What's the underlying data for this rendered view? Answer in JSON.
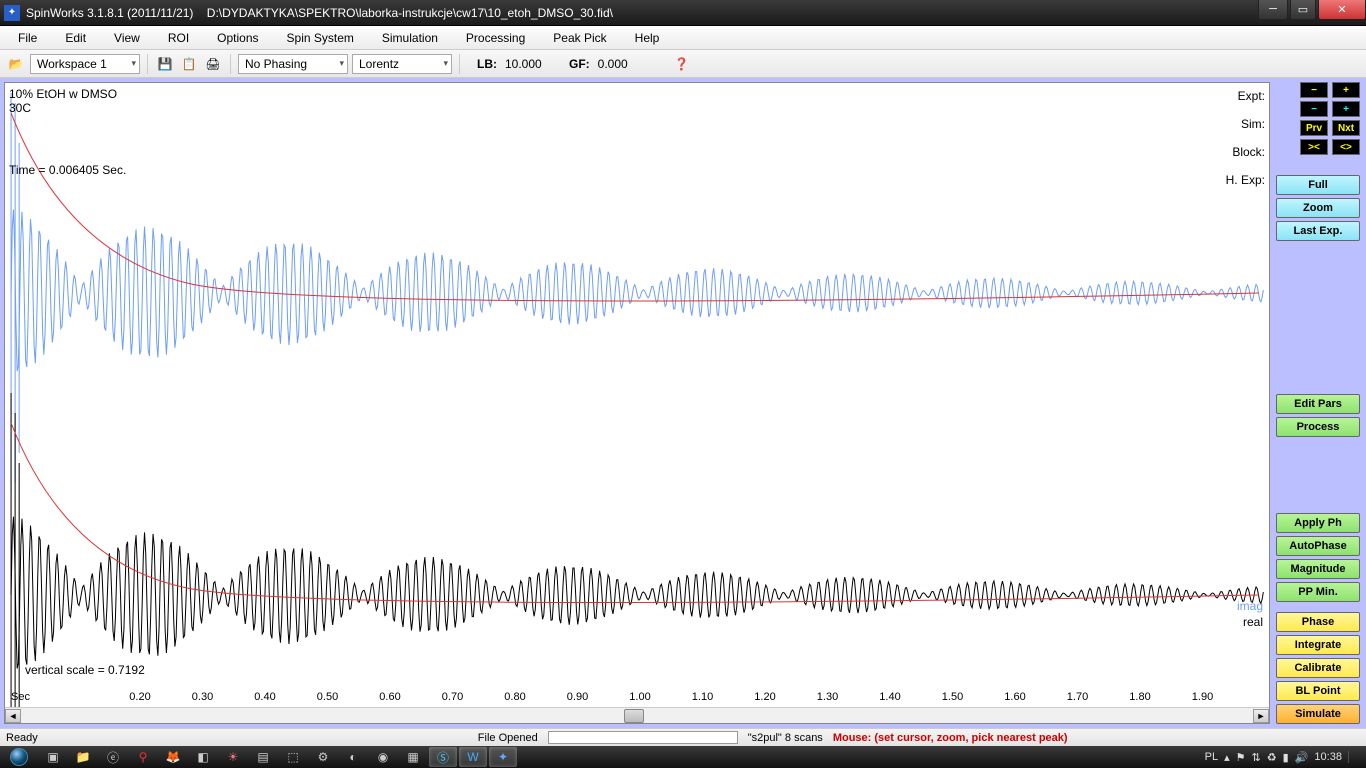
{
  "titlebar": {
    "app": "SpinWorks 3.1.8.1 (2011/11/21)",
    "path": "D:\\DYDAKTYKA\\SPEKTRO\\laborka-instrukcje\\cw17\\10_etoh_DMSO_30.fid\\"
  },
  "menu": [
    "File",
    "Edit",
    "View",
    "ROI",
    "Options",
    "Spin System",
    "Simulation",
    "Processing",
    "Peak Pick",
    "Help"
  ],
  "toolbar": {
    "workspace": "Workspace 1",
    "phasing": "No Phasing",
    "window": "Lorentz",
    "lb_label": "LB:",
    "lb_val": "10.000",
    "gf_label": "GF:",
    "gf_val": "0.000"
  },
  "plot": {
    "line1": "10% EtOH w DMSO",
    "line2": "30C",
    "time": "Time = 0.006405 Sec.",
    "vscale": "vertical scale = 0.7192",
    "imag": "imag",
    "real": "real",
    "unit": "Sec"
  },
  "rlabels": {
    "expt": "Expt:",
    "sim": "Sim:",
    "block": "Block:",
    "hexp": "H. Exp:"
  },
  "smallbtns": {
    "minus": "−",
    "plus": "+",
    "prv": "Prv",
    "nxt": "Nxt",
    "left": "><",
    "right": "<>"
  },
  "buttons": {
    "full": "Full",
    "zoom": "Zoom",
    "lastexp": "Last Exp.",
    "editpars": "Edit Pars",
    "process": "Process",
    "applyph": "Apply Ph",
    "autophase": "AutoPhase",
    "magnitude": "Magnitude",
    "ppmin": "PP Min.",
    "phase": "Phase",
    "integrate": "Integrate",
    "calibrate": "Calibrate",
    "blpoint": "BL Point",
    "simulate": "Simulate"
  },
  "xticks": [
    "0.20",
    "0.30",
    "0.40",
    "0.50",
    "0.60",
    "0.70",
    "0.80",
    "0.90",
    "1.00",
    "1.10",
    "1.20",
    "1.30",
    "1.40",
    "1.50",
    "1.60",
    "1.70",
    "1.80",
    "1.90"
  ],
  "status": {
    "ready": "Ready",
    "fileopened": "File Opened",
    "scans": "\"s2pul\"  8 scans",
    "mouse": "Mouse:  (set cursor,  zoom,  pick nearest peak)"
  },
  "tray": {
    "lang": "PL",
    "clock": "10:38"
  }
}
